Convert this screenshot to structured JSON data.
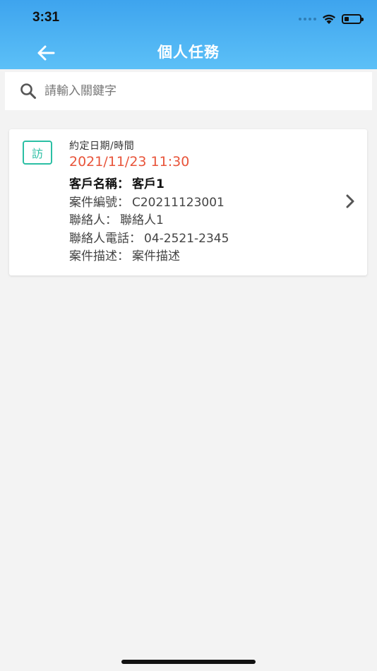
{
  "status_bar": {
    "time": "3:31"
  },
  "nav": {
    "title": "個人任務",
    "back_icon": "arrow-left-icon"
  },
  "search": {
    "placeholder": "請輸入關鍵字",
    "value": ""
  },
  "tasks": [
    {
      "badge": "訪",
      "appointment_label": "約定日期/時間",
      "appointment_datetime": "2021/11/23 11:30",
      "customer_name_label": "客戶名稱：",
      "customer_name": "客戶1",
      "case_number_label": "案件編號：",
      "case_number": "C20211123001",
      "contact_label": "聯絡人：",
      "contact": "聯絡人1",
      "contact_phone_label": "聯絡人電話：",
      "contact_phone": "04-2521-2345",
      "case_desc_label": "案件描述：",
      "case_desc": "案件描述"
    }
  ],
  "colors": {
    "header_top": "#3ea4ee",
    "header_bottom": "#5cc0f7",
    "badge": "#2bbfa4",
    "datetime": "#e8543a",
    "background": "#f3f3f3"
  }
}
